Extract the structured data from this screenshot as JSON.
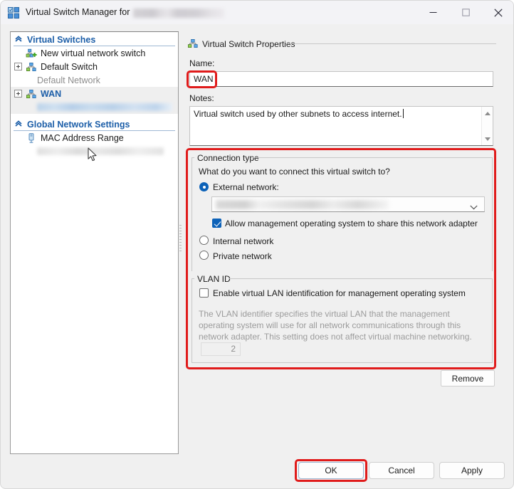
{
  "window": {
    "title_prefix": "Virtual Switch Manager for",
    "title_machine_redacted": "",
    "icon": "hyperv-switch-icon",
    "controls": {
      "minimize": "minimize-icon",
      "maximize": "maximize-icon",
      "close": "close-icon"
    }
  },
  "sidebar": {
    "groups": [
      {
        "label": "Virtual Switches",
        "icon": "collapse-chevron-icon",
        "items": [
          {
            "label": "New virtual network switch",
            "icon": "new-virtual-switch-icon",
            "expandable": false,
            "selected": false,
            "dim": false
          },
          {
            "label": "Default Switch",
            "icon": "virtual-switch-icon",
            "expandable": true,
            "selected": false,
            "dim": false
          },
          {
            "label": "Default Network",
            "icon": "",
            "expandable": false,
            "selected": false,
            "dim": true
          },
          {
            "label": "WAN",
            "icon": "virtual-switch-icon",
            "expandable": true,
            "selected": true,
            "dim": false
          },
          {
            "label": "",
            "icon": "",
            "expandable": false,
            "selected": true,
            "dim": false,
            "redacted": true
          }
        ]
      },
      {
        "label": "Global Network Settings",
        "icon": "collapse-chevron-icon",
        "items": [
          {
            "label": "MAC Address Range",
            "icon": "mac-address-icon",
            "expandable": false,
            "selected": false,
            "dim": false
          },
          {
            "label": "",
            "icon": "",
            "expandable": false,
            "selected": false,
            "dim": false,
            "redacted": true
          }
        ]
      }
    ]
  },
  "properties": {
    "section_title": "Virtual Switch Properties",
    "section_icon": "virtual-switch-icon",
    "name_label": "Name:",
    "name_value": "WAN",
    "notes_label": "Notes:",
    "notes_value": "Virtual switch used by other subnets to access internet."
  },
  "connection": {
    "group_title": "Connection type",
    "question": "What do you want to connect this virtual switch to?",
    "options": [
      {
        "label": "External network:",
        "selected": true
      },
      {
        "label": "Internal network",
        "selected": false
      },
      {
        "label": "Private network",
        "selected": false
      }
    ],
    "adapter_value_redacted": "",
    "adapter_chevron": "chevron-down-icon",
    "share_checkbox": {
      "label": "Allow management operating system to share this network adapter",
      "checked": true
    }
  },
  "vlan": {
    "group_title": "VLAN ID",
    "enable_checkbox": {
      "label": "Enable virtual LAN identification for management operating system",
      "checked": false
    },
    "description": "The VLAN identifier specifies the virtual LAN that the management operating system will use for all network communications through this network adapter. This setting does not affect virtual machine networking.",
    "id_value": "2",
    "enabled": false
  },
  "buttons": {
    "remove": "Remove",
    "ok": "OK",
    "cancel": "Cancel",
    "apply": "Apply"
  },
  "annotations": {
    "color": "#e01b1b",
    "targets": [
      "name-input",
      "connection-type-group",
      "ok-button"
    ]
  },
  "colors": {
    "accent": "#0d62b8",
    "tree_header": "#1c5ea8",
    "annotation": "#e01b1b",
    "window_bg": "#f0f0f0"
  }
}
